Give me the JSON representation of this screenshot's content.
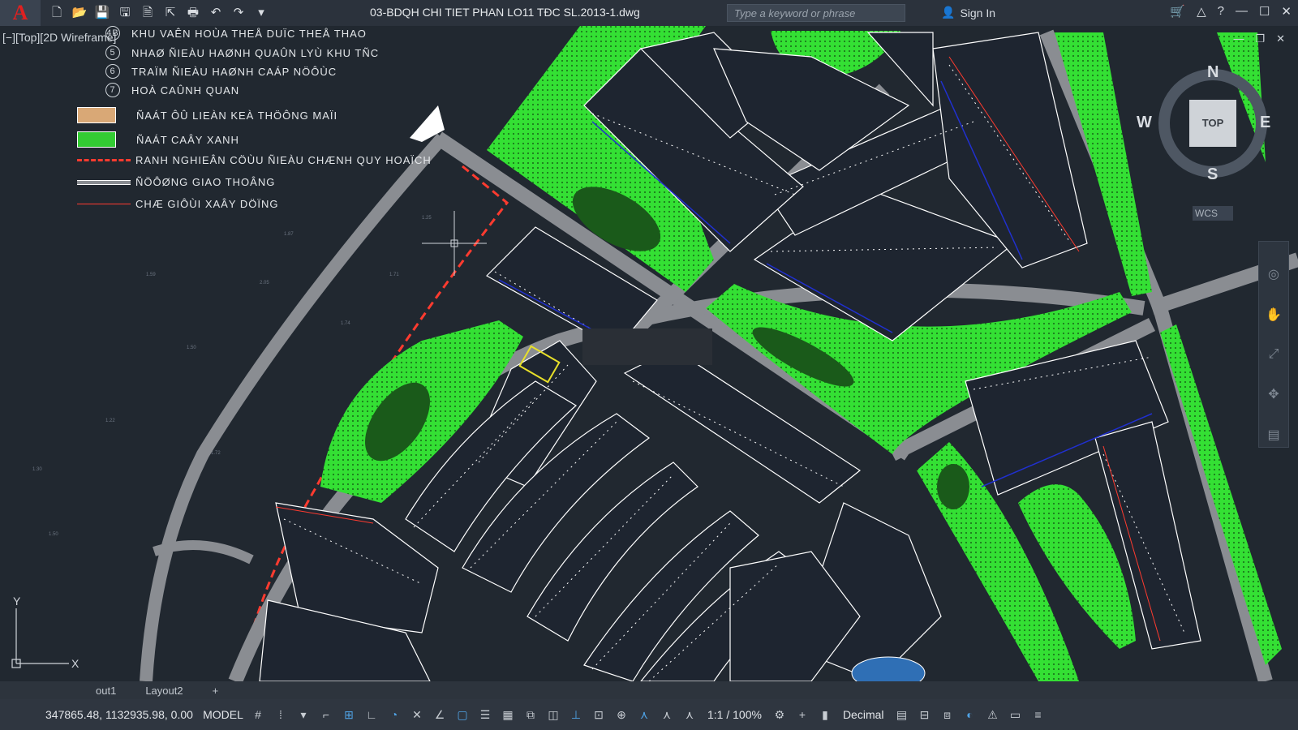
{
  "app": {
    "title": "03-BDQH CHI TIET PHAN LO11 TĐC SL.2013-1.dwg",
    "search_placeholder": "Type a keyword or phrase",
    "sign_in_label": "Sign In"
  },
  "viewport": {
    "label": "[−][Top][2D Wireframe]",
    "legend": [
      {
        "num": "4B",
        "text": "KHU VAÊN HOÙA THEÅ DUÏC THEÅ THAO"
      },
      {
        "num": "5",
        "text": "NHAØ ÑIEÀU HAØNH QUAÛN LYÙ KHU TÑC"
      },
      {
        "num": "6",
        "text": "TRAÏM ÑIEÀU HAØNH CAÁP NÖÔÙC"
      },
      {
        "num": "7",
        "text": "HOÀ CAÛNH QUAN"
      },
      {
        "swatch": "#d9a876",
        "text": "ÑAÁT ÔÛ LIEÀN KEÀ THÖÔNG MAÏI"
      },
      {
        "swatch": "#33cc33",
        "text": "ÑAÁT CAÂY XANH"
      },
      {
        "line": "red-dash",
        "text": "RANH NGHIEÂN CÖÙU ÑIEÀU CHÆNH QUY HOAÏCH"
      },
      {
        "line": "road",
        "text": "ÑÖÔØNG GIAO THOÂNG"
      },
      {
        "line": "thin-red",
        "text": "CHÆ GIÔÙI XAÂY DÖÏNG"
      }
    ],
    "viewcube": {
      "face": "TOP",
      "n": "N",
      "s": "S",
      "e": "E",
      "w": "W"
    },
    "wcs": "WCS"
  },
  "tabs": [
    "out1",
    "Layout2",
    "+"
  ],
  "status": {
    "coords": "347865.48, 1132935.98, 0.00",
    "model": "MODEL",
    "scale": "1:1 / 100%",
    "units": "Decimal"
  },
  "colors": {
    "green": "#2ee62e",
    "road": "#8a8d92",
    "block": "#1e2530",
    "red": "#ff3b2f"
  }
}
